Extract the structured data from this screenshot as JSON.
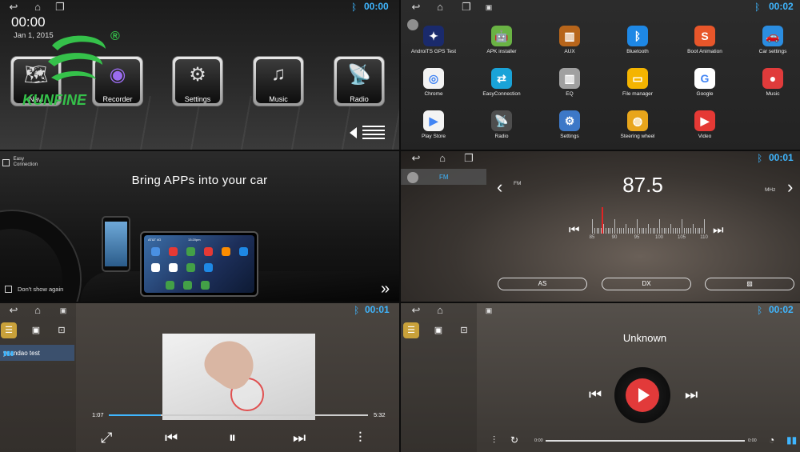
{
  "brand": {
    "name": "KUNFINE",
    "reg_mark": "®"
  },
  "panel1": {
    "clock": "00:00",
    "date": "Jan 1, 2015",
    "status_time": "00:00",
    "tiles": [
      {
        "label": "Navi",
        "icon": "map-icon"
      },
      {
        "label": "Recorder",
        "icon": "camera-icon"
      },
      {
        "label": "Settings",
        "icon": "settings-gear-icon"
      },
      {
        "label": "Music",
        "icon": "music-icon"
      },
      {
        "label": "Radio",
        "icon": "radio-icon"
      }
    ]
  },
  "panel2": {
    "status_time": "00:02",
    "apps": [
      {
        "label": "AndroiTS GPS Test",
        "icon": "gps-icon",
        "color": "#1a2a6c"
      },
      {
        "label": "APK installer",
        "icon": "android-icon",
        "color": "#6ab344"
      },
      {
        "label": "AUX",
        "icon": "aux-icon",
        "color": "#b7651b"
      },
      {
        "label": "Bluetooth",
        "icon": "bluetooth-icon",
        "color": "#1e88e5"
      },
      {
        "label": "Boot Animation",
        "icon": "boot-animation-icon",
        "color": "#e8562a"
      },
      {
        "label": "Car settings",
        "icon": "car-settings-icon",
        "color": "#2b8de0"
      },
      {
        "label": "Chrome",
        "icon": "chrome-icon",
        "color": "#f3f3f3"
      },
      {
        "label": "EasyConnection",
        "icon": "easyconnection-icon",
        "color": "#1aa3d8"
      },
      {
        "label": "EQ",
        "icon": "eq-icon",
        "color": "#a0a0a0"
      },
      {
        "label": "File manager",
        "icon": "folder-icon",
        "color": "#f4b400"
      },
      {
        "label": "Google",
        "icon": "google-icon",
        "color": "#ffffff"
      },
      {
        "label": "Music",
        "icon": "music-app-icon",
        "color": "#e03b3b"
      },
      {
        "label": "Play Store",
        "icon": "play-store-icon",
        "color": "#f3f3f3"
      },
      {
        "label": "Radio",
        "icon": "radio-app-icon",
        "color": "#4e4e4e"
      },
      {
        "label": "Settings",
        "icon": "settings-app-icon",
        "color": "#3d78c7"
      },
      {
        "label": "Steering wheel",
        "icon": "steering-wheel-icon",
        "color": "#e8a51b"
      },
      {
        "label": "Video",
        "icon": "video-icon",
        "color": "#e53935"
      }
    ]
  },
  "panel3": {
    "header": "Easy\nConnection",
    "tagline": "Bring APPs into your car",
    "carrier": "AT&T  4G",
    "phone_time": "13:20pm",
    "dont_show": "Don't show again"
  },
  "panel4": {
    "status_time": "00:01",
    "tab": "FM",
    "band": "FM",
    "frequency": "87.5",
    "unit": "MHz",
    "scale": [
      "85",
      "90",
      "95",
      "100",
      "105",
      "110"
    ],
    "buttons": [
      "AS",
      "DX"
    ]
  },
  "panel5": {
    "status_time": "00:01",
    "playlist_item": "yuandao test",
    "current_time": "1:07",
    "total_time": "5:32",
    "progress": 0.2
  },
  "panel6": {
    "status_time": "00:02",
    "title": "Unknown",
    "current_time": "0:00",
    "total_time": "0:00"
  }
}
